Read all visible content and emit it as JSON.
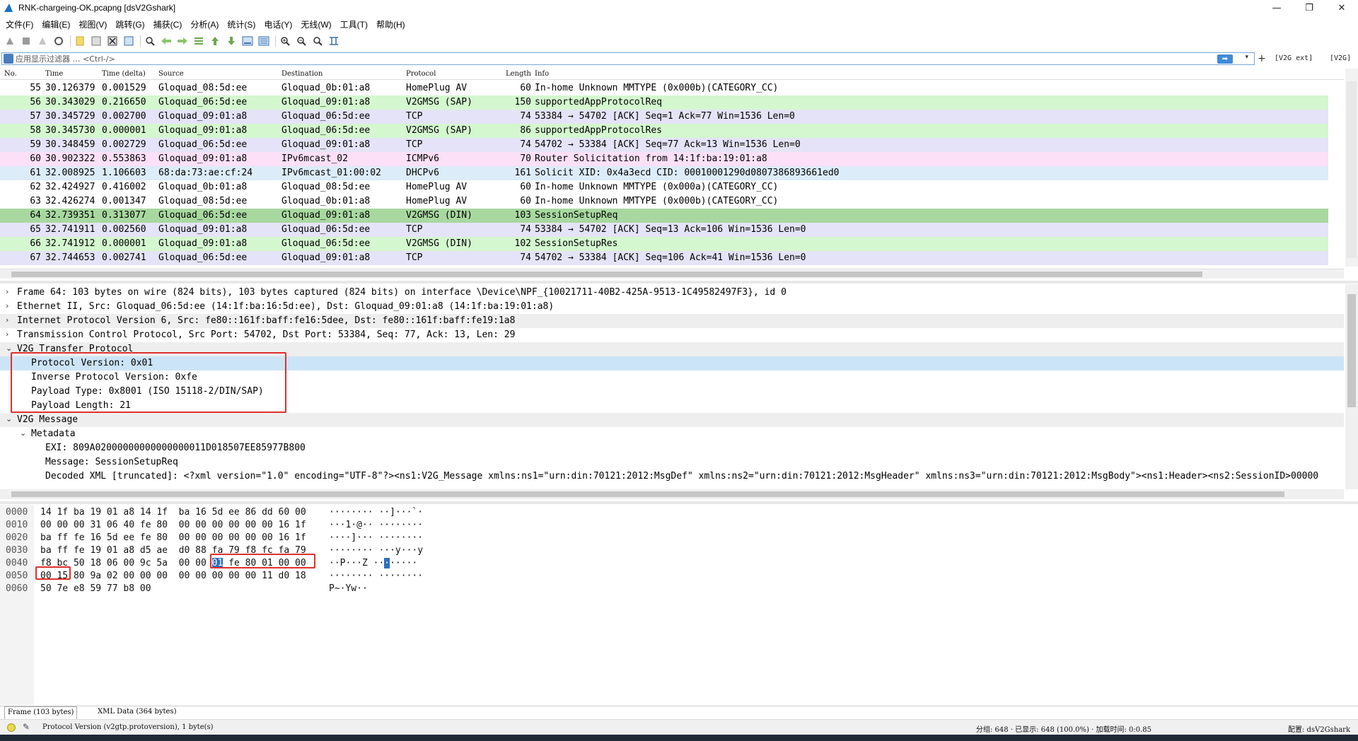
{
  "window": {
    "title": "RNK-chargeing-OK.pcapng [dsV2Gshark]",
    "minimize": "—",
    "maximize": "❐",
    "close": "✕"
  },
  "menu": [
    "文件(F)",
    "编辑(E)",
    "视图(V)",
    "跳转(G)",
    "捕获(C)",
    "分析(A)",
    "统计(S)",
    "电话(Y)",
    "无线(W)",
    "工具(T)",
    "帮助(H)"
  ],
  "filter": {
    "placeholder": "应用显示过滤器 … <Ctrl-/>",
    "apply": "➡",
    "dropdown": "▾",
    "add": "+",
    "btn1": "[V2G ext]",
    "btn2": "[V2G]"
  },
  "packet_list": {
    "columns": [
      "No.",
      "Time",
      "Time (delta)",
      "Source",
      "Destination",
      "Protocol",
      "Length",
      "Info"
    ],
    "rows": [
      {
        "no": "55",
        "time": "30.126379",
        "delta": "0.001529",
        "src": "Gloquad_08:5d:ee",
        "dst": "Gloquad_0b:01:a8",
        "proto": "HomePlug AV",
        "len": "60",
        "info": "In-home Unknown MMTYPE (0x000b)(CATEGORY_CC)",
        "bg": "#ffffff"
      },
      {
        "no": "56",
        "time": "30.343029",
        "delta": "0.216650",
        "src": "Gloquad_06:5d:ee",
        "dst": "Gloquad_09:01:a8",
        "proto": "V2GMSG (SAP)",
        "len": "150",
        "info": "supportedAppProtocolReq",
        "bg": "#d4f7cf"
      },
      {
        "no": "57",
        "time": "30.345729",
        "delta": "0.002700",
        "src": "Gloquad_09:01:a8",
        "dst": "Gloquad_06:5d:ee",
        "proto": "TCP",
        "len": "74",
        "info": "53384 → 54702 [ACK] Seq=1 Ack=77 Win=1536 Len=0",
        "bg": "#e5e3f7"
      },
      {
        "no": "58",
        "time": "30.345730",
        "delta": "0.000001",
        "src": "Gloquad_09:01:a8",
        "dst": "Gloquad_06:5d:ee",
        "proto": "V2GMSG (SAP)",
        "len": "86",
        "info": "supportedAppProtocolRes",
        "bg": "#d4f7cf"
      },
      {
        "no": "59",
        "time": "30.348459",
        "delta": "0.002729",
        "src": "Gloquad_06:5d:ee",
        "dst": "Gloquad_09:01:a8",
        "proto": "TCP",
        "len": "74",
        "info": "54702 → 53384 [ACK] Seq=77 Ack=13 Win=1536 Len=0",
        "bg": "#e5e3f7"
      },
      {
        "no": "60",
        "time": "30.902322",
        "delta": "0.553863",
        "src": "Gloquad_09:01:a8",
        "dst": "IPv6mcast_02",
        "proto": "ICMPv6",
        "len": "70",
        "info": "Router Solicitation from 14:1f:ba:19:01:a8",
        "bg": "#fbe0f7"
      },
      {
        "no": "61",
        "time": "32.008925",
        "delta": "1.106603",
        "src": "68:da:73:ae:cf:24",
        "dst": "IPv6mcast_01:00:02",
        "proto": "DHCPv6",
        "len": "161",
        "info": "Solicit XID: 0x4a3ecd CID: 00010001290d0807386893661ed0",
        "bg": "#dcecf8"
      },
      {
        "no": "62",
        "time": "32.424927",
        "delta": "0.416002",
        "src": "Gloquad_0b:01:a8",
        "dst": "Gloquad_08:5d:ee",
        "proto": "HomePlug AV",
        "len": "60",
        "info": "In-home Unknown MMTYPE (0x000a)(CATEGORY_CC)",
        "bg": "#ffffff"
      },
      {
        "no": "63",
        "time": "32.426274",
        "delta": "0.001347",
        "src": "Gloquad_08:5d:ee",
        "dst": "Gloquad_0b:01:a8",
        "proto": "HomePlug AV",
        "len": "60",
        "info": "In-home Unknown MMTYPE (0x000b)(CATEGORY_CC)",
        "bg": "#ffffff"
      },
      {
        "no": "64",
        "time": "32.739351",
        "delta": "0.313077",
        "src": "Gloquad_06:5d:ee",
        "dst": "Gloquad_09:01:a8",
        "proto": "V2GMSG (DIN)",
        "len": "103",
        "info": "SessionSetupReq",
        "bg": "#a8d8a0"
      },
      {
        "no": "65",
        "time": "32.741911",
        "delta": "0.002560",
        "src": "Gloquad_09:01:a8",
        "dst": "Gloquad_06:5d:ee",
        "proto": "TCP",
        "len": "74",
        "info": "53384 → 54702 [ACK] Seq=13 Ack=106 Win=1536 Len=0",
        "bg": "#e5e3f7"
      },
      {
        "no": "66",
        "time": "32.741912",
        "delta": "0.000001",
        "src": "Gloquad_09:01:a8",
        "dst": "Gloquad_06:5d:ee",
        "proto": "V2GMSG (DIN)",
        "len": "102",
        "info": "SessionSetupRes",
        "bg": "#d4f7cf"
      },
      {
        "no": "67",
        "time": "32.744653",
        "delta": "0.002741",
        "src": "Gloquad_06:5d:ee",
        "dst": "Gloquad_09:01:a8",
        "proto": "TCP",
        "len": "74",
        "info": "54702 → 53384 [ACK] Seq=106 Ack=41 Win=1536 Len=0",
        "bg": "#e5e3f7"
      }
    ]
  },
  "details": [
    {
      "arrow": "›",
      "indent": 0,
      "text": "Frame 64: 103 bytes on wire (824 bits), 103 bytes captured (824 bits) on interface \\Device\\NPF_{10021711-40B2-425A-9513-1C49582497F3}, id 0",
      "bg": "#ffffff"
    },
    {
      "arrow": "›",
      "indent": 0,
      "text": "Ethernet II, Src: Gloquad_06:5d:ee (14:1f:ba:16:5d:ee), Dst: Gloquad_09:01:a8 (14:1f:ba:19:01:a8)",
      "bg": "#ffffff"
    },
    {
      "arrow": "›",
      "indent": 0,
      "text": "Internet Protocol Version 6, Src: fe80::161f:baff:fe16:5dee, Dst: fe80::161f:baff:fe19:1a8",
      "bg": "#eeeeee"
    },
    {
      "arrow": "›",
      "indent": 0,
      "text": "Transmission Control Protocol, Src Port: 54702, Dst Port: 53384, Seq: 77, Ack: 13, Len: 29",
      "bg": "#ffffff"
    },
    {
      "arrow": "⌄",
      "indent": 0,
      "text": "V2G Transfer Protocol",
      "bg": "#eeeeee"
    },
    {
      "arrow": "",
      "indent": 1,
      "text": "Protocol Version: 0x01",
      "bg": "#cce4f7"
    },
    {
      "arrow": "",
      "indent": 1,
      "text": "Inverse Protocol Version: 0xfe",
      "bg": "#ffffff"
    },
    {
      "arrow": "",
      "indent": 1,
      "text": "Payload Type: 0x8001 (ISO 15118-2/DIN/SAP)",
      "bg": "#ffffff"
    },
    {
      "arrow": "",
      "indent": 1,
      "text": "Payload Length: 21",
      "bg": "#ffffff"
    },
    {
      "arrow": "⌄",
      "indent": 0,
      "text": "V2G Message",
      "bg": "#eeeeee"
    },
    {
      "arrow": "⌄",
      "indent": 1,
      "text": "Metadata",
      "bg": "#ffffff"
    },
    {
      "arrow": "",
      "indent": 2,
      "text": "EXI: 809A02000000000000000011D018507EE85977B800",
      "bg": "#ffffff"
    },
    {
      "arrow": "",
      "indent": 2,
      "text": "Message: SessionSetupReq",
      "bg": "#ffffff"
    },
    {
      "arrow": "",
      "indent": 2,
      "text": "Decoded XML [truncated]: <?xml version=\"1.0\" encoding=\"UTF-8\"?><ns1:V2G_Message xmlns:ns1=\"urn:din:70121:2012:MsgDef\" xmlns:ns2=\"urn:din:70121:2012:MsgHeader\" xmlns:ns3=\"urn:din:70121:2012:MsgBody\"><ns1:Header><ns2:SessionID>00000",
      "bg": "#ffffff"
    }
  ],
  "bytes": [
    {
      "off": "0000",
      "hex": "14 1f ba 19 01 a8 14 1f  ba 16 5d ee 86 dd 60 00",
      "ascii": "········ ··]···`·"
    },
    {
      "off": "0010",
      "hex": "00 00 00 31 06 40 fe 80  00 00 00 00 00 00 16 1f",
      "ascii": "···1·@·· ········"
    },
    {
      "off": "0020",
      "hex": "ba ff fe 16 5d ee fe 80  00 00 00 00 00 00 16 1f",
      "ascii": "····]··· ········"
    },
    {
      "off": "0030",
      "hex": "ba ff fe 19 01 a8 d5 ae  d0 88 fa 79 f8 fc fa 79",
      "ascii": "········ ···y···y"
    },
    {
      "off": "0040",
      "hex": "f8 bc 50 18 06 00 9c 5a  00 00 ",
      "hex_hl": "01",
      "hex_rest": " fe 80 01 00 00",
      "ascii": "··P···Z ··",
      "ascii_hl": "·",
      "ascii_rest": "·····"
    },
    {
      "off": "0050",
      "hex": "00 15 80 9a 02 00 00 00  00 00 00 00 00 11 d0 18",
      "ascii": "········ ········"
    },
    {
      "off": "0060",
      "hex": "50 7e e8 59 77 b8 00",
      "ascii": "P~·Yw··"
    }
  ],
  "bottom_tabs": [
    "Frame (103 bytes)",
    "XML Data (364 bytes)"
  ],
  "status": {
    "field": "Protocol Version (v2gtp.protoversion), 1 byte(s)",
    "packets": "分组: 648 · 已显示: 648 (100.0%) · 加载时间: 0:0.85",
    "profile": "配置: dsV2Gshark"
  },
  "colors": {
    "selected_row": "#a8d8a0",
    "highlight_box": "#e0302b",
    "byte_highlight": "#2e6ebf"
  }
}
